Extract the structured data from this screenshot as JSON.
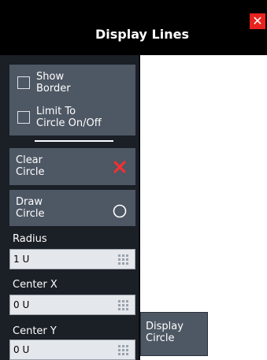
{
  "dialog": {
    "title": "Display Lines",
    "close_icon": "close-icon"
  },
  "buttons": {
    "show_border": "Show\nBorder",
    "limit_to_circle": "Limit To\nCircle On/Off",
    "clear_circle": "Clear\nCircle",
    "draw_circle": "Draw\nCircle",
    "display_circle": "Display\nCircle"
  },
  "fields": {
    "radius": {
      "label": "Radius",
      "value": "1 U"
    },
    "center_x": {
      "label": "Center X",
      "value": "0 U"
    },
    "center_y": {
      "label": "Center Y",
      "value": "0 U"
    }
  },
  "icons": {
    "clear": "x-icon",
    "draw": "circle-icon",
    "keypad": "keypad-grip-icon"
  },
  "colors": {
    "header": "#000000",
    "panel": "#1b1f26",
    "button": "#4e5764",
    "field": "#e4e7eb",
    "close": "#e8221e",
    "clear_x": "#ff2e2e"
  }
}
